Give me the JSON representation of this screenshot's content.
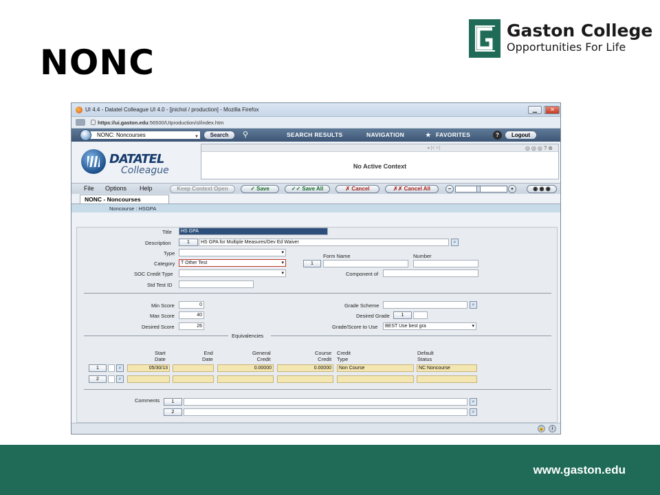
{
  "slide": {
    "title": "NONC",
    "logo_name": "Gaston College",
    "logo_tagline": "Opportunities For Life",
    "footer_url": "www.gaston.edu",
    "brand_color": "#1f6b57"
  },
  "browser": {
    "title": "UI 4.4 - Datatel Colleague UI 4.0 - [jnichol / production] - Mozilla Firefox",
    "url_host": "https://ui.gaston.edu",
    "url_path": ":56500/UIproduction/sl/index.htm",
    "min_label": "▁",
    "max_label": "▢",
    "close_label": "✕"
  },
  "topnav": {
    "mnemonic_value": "NONC: Noncourses",
    "search_label": "Search",
    "search_results_label": "SEARCH RESULTS",
    "navigation_label": "NAVIGATION",
    "favorites_label": "FAVORITES",
    "help_label": "?",
    "logout_label": "Logout"
  },
  "brand": {
    "line1": "DATATEL",
    "line2": "Colleague"
  },
  "context": {
    "message": "No Active Context",
    "icons": "◎◎◎?⊗",
    "arrows": "◂  |<              >|"
  },
  "menubar": {
    "file": "File",
    "options": "Options",
    "help": "Help",
    "keep_context": "Keep Context Open",
    "save": "✓ Save",
    "save_all": "✓✓ Save All",
    "cancel": "✗ Cancel",
    "cancel_all": "✗✗ Cancel All",
    "zoom_out": "−",
    "zoom_in": "+"
  },
  "form": {
    "tab_label": "NONC - Noncourses",
    "key_line": "Noncourse :  HSGPA",
    "title_label": "Title",
    "title_value": "HS GPA",
    "description_label": "Description",
    "description_seq": "1",
    "description_value": "HS GPA for Multiple Measures/Dev Ed Waiver",
    "type_label": "Type",
    "type_value": "",
    "form_name_label": "Form Name",
    "number_label": "Number",
    "category_label": "Category",
    "category_value": "T Other Test",
    "form_seq": "1",
    "form_name_value": "",
    "number_value": "",
    "soc_label": "SOC Credit Type",
    "soc_value": "",
    "component_label": "Component of",
    "component_value": "",
    "std_test_label": "Std Test ID",
    "std_test_value": "",
    "min_score_label": "Min Score",
    "min_score_value": "0",
    "max_score_label": "Max Score",
    "max_score_value": "40",
    "desired_score_label": "Desired Score",
    "desired_score_value": "26",
    "grade_scheme_label": "Grade Scheme",
    "grade_scheme_value": "",
    "desired_grade_label": "Desired Grade",
    "desired_grade_seq": "1",
    "desired_grade_value": "",
    "grade_score_label": "Grade/Score to Use",
    "grade_score_value": "BEST Use best gra",
    "equivalencies_label": "Equivalencies",
    "col_start": [
      "Start",
      "Date"
    ],
    "col_end": [
      "End",
      "Date"
    ],
    "col_general": [
      "General",
      "Credit"
    ],
    "col_course": [
      "Course",
      "Credit"
    ],
    "col_credit_type": [
      "Credit",
      "Type"
    ],
    "col_default": [
      "Default",
      "Status"
    ],
    "rows": [
      {
        "seq": "1",
        "start": "05/30/13",
        "end": "",
        "general": "0.00000",
        "course": "0.00000",
        "type": "Non Course",
        "status": "NC Noncourse"
      },
      {
        "seq": "2",
        "start": "",
        "end": "",
        "general": "",
        "course": "",
        "type": "",
        "status": ""
      }
    ],
    "comments_label": "Comments",
    "comments": [
      {
        "seq": "1",
        "value": ""
      },
      {
        "seq": "2",
        "value": ""
      }
    ]
  }
}
